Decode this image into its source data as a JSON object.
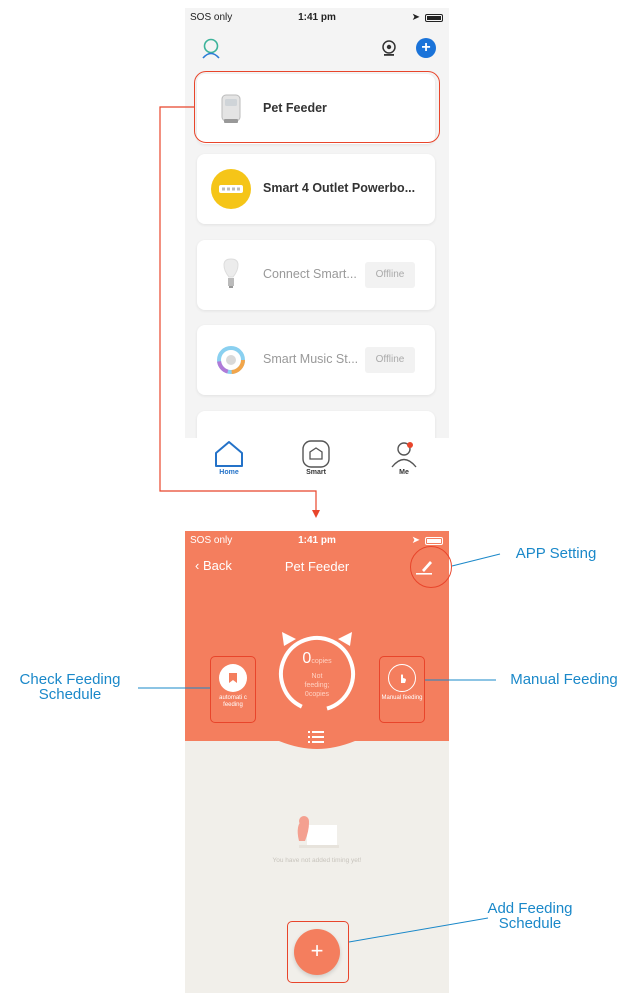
{
  "top_screen": {
    "status": {
      "carrier": "SOS only",
      "time": "1:41 pm"
    },
    "devices": [
      {
        "name": "Pet Feeder",
        "status": ""
      },
      {
        "name": "Smart 4 Outlet Powerbo...",
        "status": ""
      },
      {
        "name": "Connect Smart...",
        "status": "Offline"
      },
      {
        "name": "Smart Music St...",
        "status": "Offline"
      }
    ],
    "tabs": [
      {
        "label": "Home"
      },
      {
        "label": "Smart"
      },
      {
        "label": "Me"
      }
    ]
  },
  "bottom_screen": {
    "status": {
      "carrier": "SOS only",
      "time": "1:41 pm"
    },
    "back_label": "Back",
    "title": "Pet Feeder",
    "dial": {
      "count": "0",
      "unit": "copies",
      "status_line1": "Not",
      "status_line2": "feeding;",
      "status_line3": "0copies"
    },
    "auto_button_label": "automati c feeding",
    "manual_button_label": "Manual feeding",
    "empty_message": "You have not added timing yet!",
    "fab_label": "+"
  },
  "annotations": {
    "app_setting": "APP Setting",
    "check_schedule_line1": "Check Feeding",
    "check_schedule_line2": "Schedule",
    "manual_feeding": "Manual Feeding",
    "add_schedule_line1": "Add Feeding",
    "add_schedule_line2": "Schedule"
  },
  "colors": {
    "accent_orange": "#f47e5e",
    "annotation_red": "#e8452b",
    "annotation_blue": "#1a88c9",
    "tab_active": "#2472c8"
  }
}
